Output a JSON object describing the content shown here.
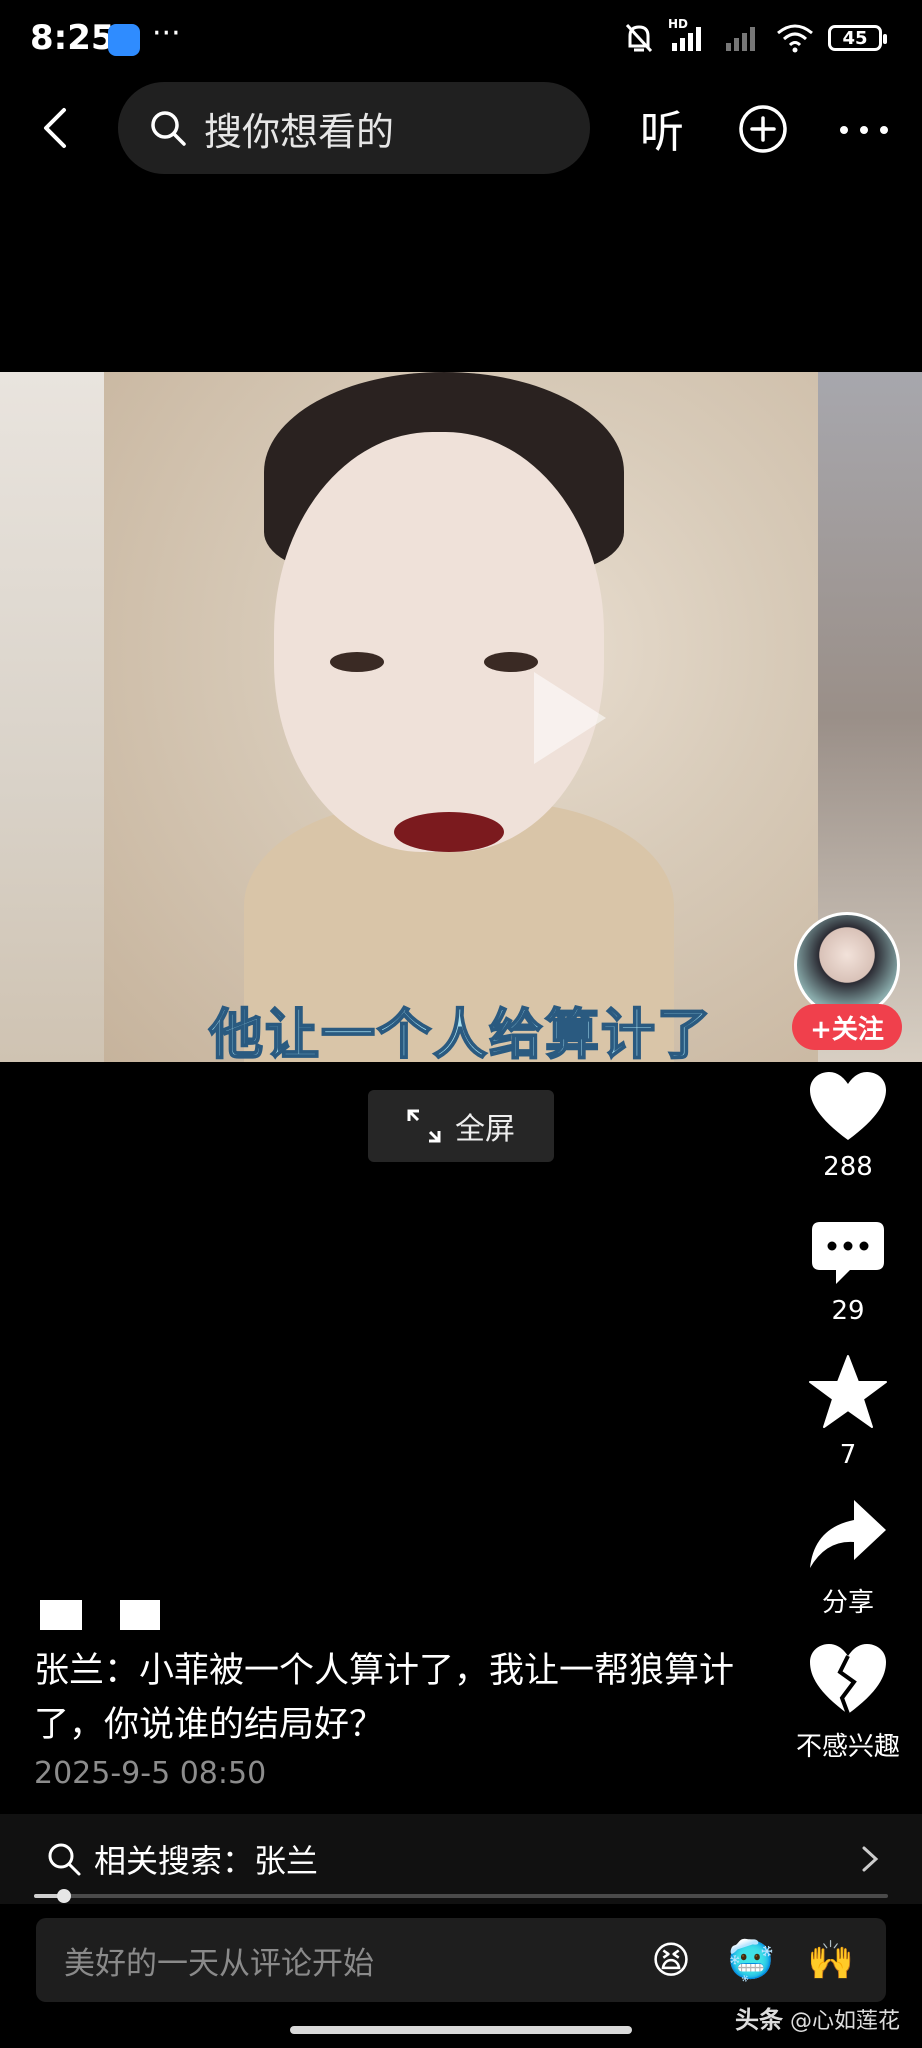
{
  "status_bar": {
    "time": "8:25",
    "dots": "···",
    "battery": "45",
    "network_label": "HD"
  },
  "top_bar": {
    "search_placeholder": "搜你想看的",
    "listen_label": "听"
  },
  "video": {
    "subtitle": "他让一个人给算计了",
    "fullscreen_label": "全屏"
  },
  "creator": {
    "follow_label": "+关注"
  },
  "actions": {
    "likes": "288",
    "comments": "29",
    "favorites": "7",
    "share_label": "分享",
    "dislike_label": "不感兴趣"
  },
  "post": {
    "caption": "张兰：小菲被一个人算计了，我让一帮狼算计了，你说谁的结局好？",
    "date": "2025-9-5 08:50"
  },
  "related_search": {
    "prefix": "相关搜索：",
    "term": "张兰"
  },
  "playback": {
    "progress": 0.035
  },
  "comment_bar": {
    "placeholder": "美好的一天从评论开始",
    "emojis": [
      "😫",
      "🥶",
      "🙌"
    ]
  },
  "watermark": {
    "brand": "头条",
    "author": "@心如莲花"
  },
  "colors": {
    "background": "#000000",
    "follow_button": "#f0404c",
    "subtitle_fill": "#a8e0f0",
    "date_text": "#8c8c8c"
  }
}
